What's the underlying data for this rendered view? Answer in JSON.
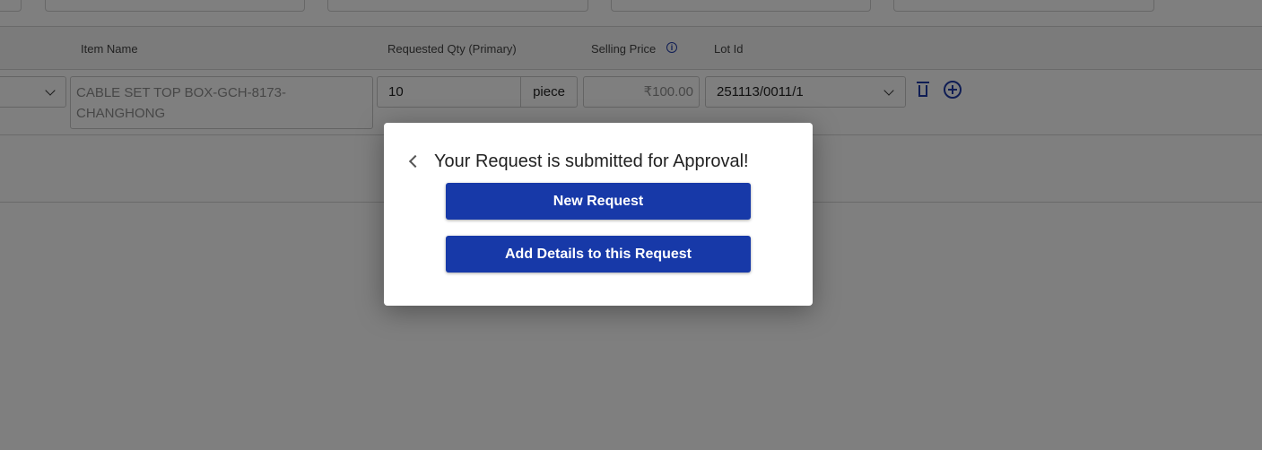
{
  "table": {
    "headers": {
      "item_name": "Item Name",
      "requested_qty": "Requested Qty (Primary)",
      "selling_price": "Selling Price",
      "lot_id": "Lot Id"
    },
    "row": {
      "item_name": "CABLE SET TOP BOX-GCH-8173-CHANGHONG",
      "quantity": "10",
      "unit": "piece",
      "selling_price": "₹100.00",
      "lot_id": "251113/0011/1"
    }
  },
  "icons": {
    "info": "info-icon",
    "delete": "trash-icon",
    "add": "plus-circle-icon",
    "back": "chevron-left-icon",
    "dropdown": "chevron-down-icon"
  },
  "modal": {
    "title": "Your Request is submitted for Approval!",
    "new_request_label": "New Request",
    "add_details_label": "Add Details to this Request"
  },
  "colors": {
    "primary": "#1739a8",
    "icon_blue": "#1e3aa8",
    "overlay": "rgba(0,0,0,0.5)"
  }
}
